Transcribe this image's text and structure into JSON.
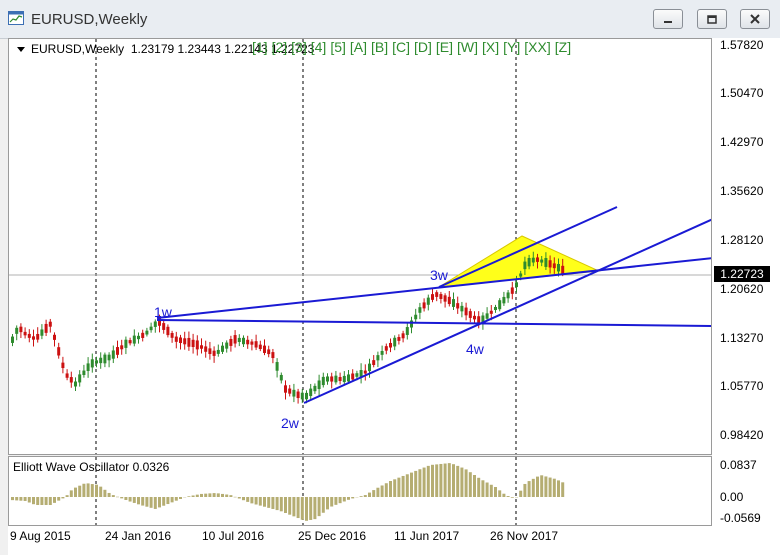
{
  "window": {
    "title": "EURUSD,Weekly"
  },
  "header": {
    "symbol": "EURUSD,Weekly",
    "ohlc": "1.23179 1.23443 1.22143 1.22723",
    "wave_labels": [
      "[1]",
      "[2]",
      "[3]",
      "[4]",
      "[5]",
      "[A]",
      "[B]",
      "[C]",
      "[D]",
      "[E]",
      "[W]",
      "[X]",
      "[Y]",
      "[XX]",
      "[Z]"
    ]
  },
  "price_scale": [
    "1.57820",
    "1.50470",
    "1.42970",
    "1.35620",
    "1.28120",
    "1.20620",
    "1.13270",
    "1.05770",
    "0.98420"
  ],
  "current_price": "1.22723",
  "time_scale": [
    "9 Aug 2015",
    "24 Jan 2016",
    "10 Jul 2016",
    "25 Dec 2016",
    "11 Jun 2017",
    "26 Nov 2017"
  ],
  "wave_marks": [
    "1w",
    "2w",
    "3w",
    "4w"
  ],
  "oscillator": {
    "title": "Elliott Wave Oscillator 0.0326",
    "scale": [
      "0.0837",
      "0.00",
      "-0.0569"
    ]
  },
  "colors": {
    "bull_candle": "#2e8b2e",
    "bear_candle": "#cc1111",
    "trendline": "#1a1ad4",
    "triangle_fill": "#ffff1a",
    "histogram": "#b5ad72",
    "wave_label": "#2e8b2e"
  },
  "icons": {
    "window": "chart-window-icon",
    "minimize": "minimize-icon",
    "restore": "restore-icon",
    "close": "close-icon"
  }
}
